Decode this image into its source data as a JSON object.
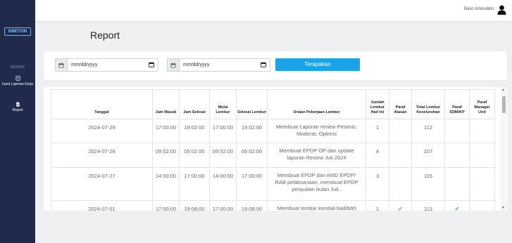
{
  "sidebar": {
    "logo_text": "DBETON",
    "section_label": "ASSOSI",
    "items": [
      {
        "label": "Input Laporan Kerja",
        "icon": "document-icon"
      },
      {
        "label": "Report",
        "icon": "report-icon"
      }
    ]
  },
  "topbar": {
    "user_name": "Baso Amiruddin",
    "user_icon": "user-icon"
  },
  "page": {
    "title": "Report"
  },
  "filter": {
    "start_placeholder": "mm/dd/yyyy",
    "end_placeholder": "mm/dd/yyyy",
    "apply_label": "Terapakan"
  },
  "table": {
    "headers": [
      "Tanggal",
      "Jam Masuk",
      "Jam Selesai",
      "Mulai Lembur",
      "Selesai Lembur",
      "Uraian Pekerjaan Lembur",
      "Jumlah Lembur Hari Ini",
      "Paraf Atasan",
      "Total Lembur Keseluruhan",
      "Paraf SDM/KP",
      "Paraf Manager Unit"
    ],
    "rows": [
      {
        "tanggal": "2024-07-29",
        "jam_masuk": "17:00:00",
        "jam_selesai": "19:02:00",
        "mulai_lembur": "17:00:00",
        "selesai_lembur": "19:02:00",
        "uraian": "Membuat Laporan review Pesimis, Moderat, Optimis",
        "jumlah": "1",
        "paraf_atasan": "",
        "total": "112",
        "paraf_sdm": "",
        "paraf_manager": ""
      },
      {
        "tanggal": "2024-07-28",
        "jam_masuk": "09:52:00",
        "jam_selesai": "05:02:00",
        "mulai_lembur": "09:52:00",
        "selesai_lembur": "05:02:00",
        "uraian": "Membuat EPDP OP dan update laporan Review Juli 2024",
        "jumlah": "4",
        "paraf_atasan": "",
        "total": "107",
        "paraf_sdm": "",
        "paraf_manager": ""
      },
      {
        "tanggal": "2024-07-27",
        "jam_masuk": "14:00:00",
        "jam_selesai": "17:00:00",
        "mulai_lembur": "14:00:00",
        "selesai_lembur": "17:00:00",
        "uraian": "Membuat EPDP dan AMD EPDP/ RAB pelaksanaan, membuat EPDP penjualan bulan Juli..",
        "jumlah": "3",
        "paraf_atasan": "",
        "total": "115",
        "paraf_sdm": "",
        "paraf_manager": ""
      },
      {
        "tanggal": "2024-07-01",
        "jam_masuk": "17:00:00",
        "jam_selesai": "19:08:00",
        "mulai_lembur": "17:00:00",
        "selesai_lembur": "19:08:00",
        "uraian": "Membuat lembar kendali bad/bdd",
        "jumlah": "1",
        "paraf_atasan": "✓",
        "total": "113",
        "paraf_sdm": "✓",
        "paraf_manager": ""
      }
    ]
  },
  "colors": {
    "sidebar": "#1f2a4d",
    "accent": "#1aa3e8",
    "check": "#2bb34a"
  }
}
